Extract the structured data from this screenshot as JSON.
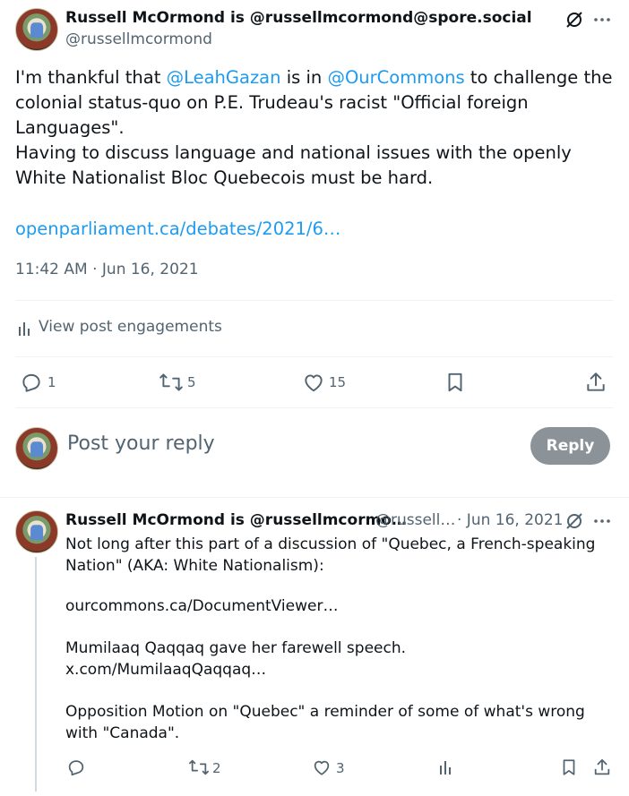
{
  "main_post": {
    "author_name": "Russell McOrmond is @russellmcormond@spore.social",
    "author_handle": "@russellmcormond",
    "text_part1": "I'm thankful that ",
    "mention1": "@LeahGazan",
    "text_part2": " is in ",
    "mention2": "@OurCommons",
    "text_part3": " to challenge the colonial status-quo on P.E. Trudeau's racist \"Official foreign Languages\".",
    "paragraph2": "Having to discuss language and national issues with the openly White Nationalist Bloc Quebecois must be hard.",
    "link": "openparliament.ca/debates/2021/6…",
    "timestamp": "11:42 AM · Jun 16, 2021",
    "view_engagements": "View post engagements",
    "replies": "1",
    "reposts": "5",
    "likes": "15"
  },
  "reply_box": {
    "placeholder": "Post your reply",
    "button": "Reply"
  },
  "thread_reply": {
    "author_name": "Russell McOrmond is @russellmcormo…",
    "author_handle": "@russell…",
    "date": "· Jun 16, 2021",
    "line1": "Not long after this part of a discussion of \"Quebec, a French-speaking Nation\" (AKA: White Nationalism):",
    "link1": "ourcommons.ca/DocumentViewer…",
    "line2": "Mumilaaq Qaqqaq gave her farewell speech.",
    "link2": "x.com/MumilaaqQaqqaq…",
    "line3": "Opposition Motion on \"Quebec\" a reminder of some of what's wrong with \"Canada\".",
    "replies": "",
    "reposts": "2",
    "likes": "3"
  },
  "icons": {
    "grok": "slashed-circle-icon",
    "more": "more-icon",
    "reply": "reply-icon",
    "repost": "repost-icon",
    "like": "heart-icon",
    "bookmark": "bookmark-icon",
    "share": "share-icon",
    "analytics": "analytics-icon"
  },
  "colors": {
    "link": "#1d9bf0",
    "muted": "#536471",
    "reply_button": "#8b9298"
  }
}
